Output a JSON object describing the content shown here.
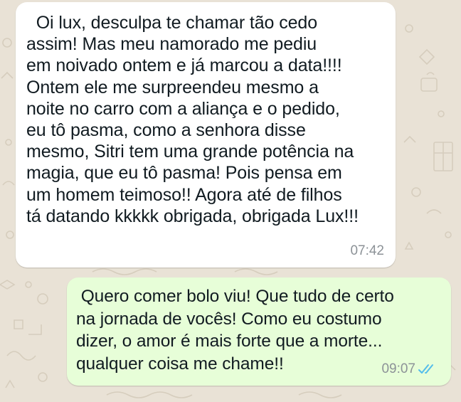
{
  "messages": {
    "incoming": {
      "lines": [
        "  Oi lux, desculpa te chamar tão cedo",
        "assim! Mas meu namorado me pediu",
        "em noivado ontem e já marcou a data!!!!",
        "Ontem ele me surpreendeu mesmo a",
        "noite no carro com a aliança e o pedido,",
        "eu tô pasma, como a senhora disse",
        "mesmo, Sitri tem uma grande potência na",
        "magia, que eu tô pasma! Pois pensa em",
        "um homem teimoso!! Agora até de filhos",
        "tá datando kkkkk obrigada, obrigada Lux!!!"
      ],
      "time": "07:42"
    },
    "outgoing": {
      "lines": [
        " Quero comer bolo viu! Que tudo de certo",
        "na jornada de vocês! Como eu costumo",
        "dizer, o amor é mais forte que a morte...",
        "qualquer coisa me chame!!"
      ],
      "time": "09:07",
      "status_icon": "double-check-read-icon",
      "status_color": "#53bdeb"
    }
  },
  "theme": {
    "wallpaper_color": "#e9e2d6",
    "incoming_bubble_color": "#ffffff",
    "outgoing_bubble_color": "#e7fed8"
  }
}
